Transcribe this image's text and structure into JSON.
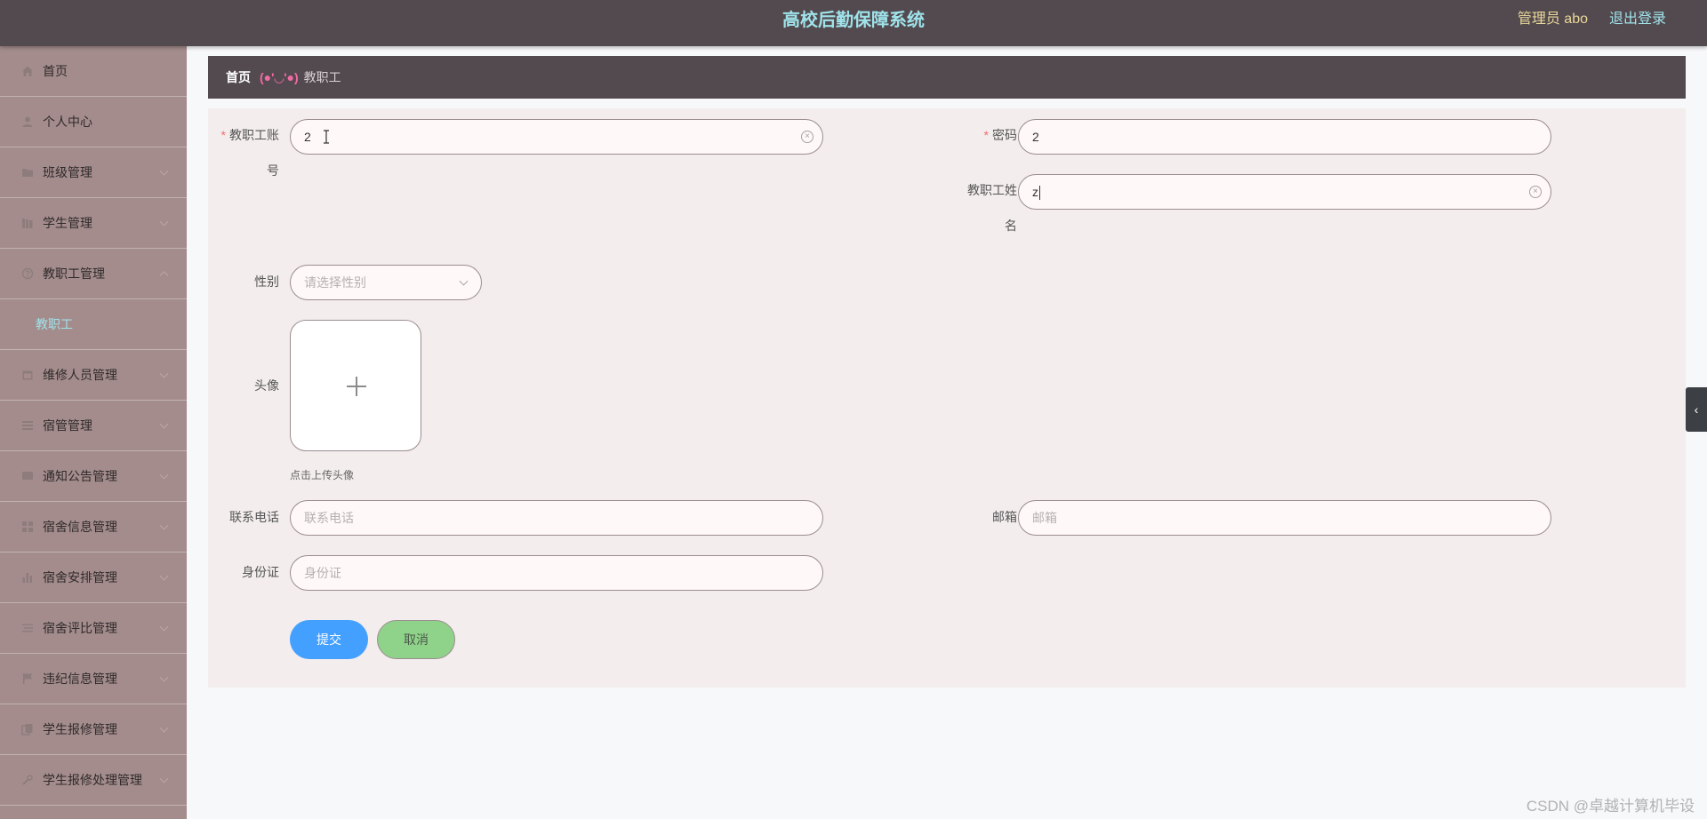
{
  "header": {
    "title": "高校后勤保障系统",
    "user": "管理员 abo",
    "logout": "退出登录",
    "title_color": "#9fe3ea",
    "user_color": "#e9d89a"
  },
  "sidebar": {
    "items": [
      {
        "label": "首页",
        "icon": "home-icon"
      },
      {
        "label": "个人中心",
        "icon": "user-icon"
      },
      {
        "label": "班级管理",
        "icon": "folder-icon"
      },
      {
        "label": "学生管理",
        "icon": "books-icon"
      },
      {
        "label": "教职工管理",
        "icon": "help-circle-icon",
        "expanded": true
      },
      {
        "label": "维修人员管理",
        "icon": "calendar-icon"
      },
      {
        "label": "宿管管理",
        "icon": "list-icon"
      },
      {
        "label": "通知公告管理",
        "icon": "message-icon"
      },
      {
        "label": "宿舍信息管理",
        "icon": "grid-icon"
      },
      {
        "label": "宿舍安排管理",
        "icon": "bar-chart-icon"
      },
      {
        "label": "宿舍评比管理",
        "icon": "menu-lines-icon"
      },
      {
        "label": "违纪信息管理",
        "icon": "flag-icon"
      },
      {
        "label": "学生报修管理",
        "icon": "copy-icon"
      },
      {
        "label": "学生报修处理管理",
        "icon": "tools-icon"
      }
    ],
    "active_sub": "教职工",
    "bg_color": "#a48c8c"
  },
  "breadcrumb": {
    "home": "首页",
    "face": "(●'◡'●)",
    "current": "教职工"
  },
  "form": {
    "account": {
      "label_a": "教职工账",
      "label_b": "号",
      "value": "2"
    },
    "password": {
      "label": "密码",
      "value": "2"
    },
    "name": {
      "label_a": "教职工姓",
      "label_b": "名",
      "value": "z"
    },
    "gender": {
      "label": "性别",
      "placeholder": "请选择性别"
    },
    "avatar": {
      "label": "头像",
      "hint": "点击上传头像"
    },
    "phone": {
      "label": "联系电话",
      "placeholder": "联系电话"
    },
    "email": {
      "label": "邮箱",
      "placeholder": "邮箱"
    },
    "idcard": {
      "label": "身份证",
      "placeholder": "身份证"
    },
    "submit": "提交",
    "cancel": "取消",
    "submit_color": "#44a0ff",
    "cancel_color": "#8fd28a"
  },
  "watermark": "CSDN @卓越计算机毕设"
}
